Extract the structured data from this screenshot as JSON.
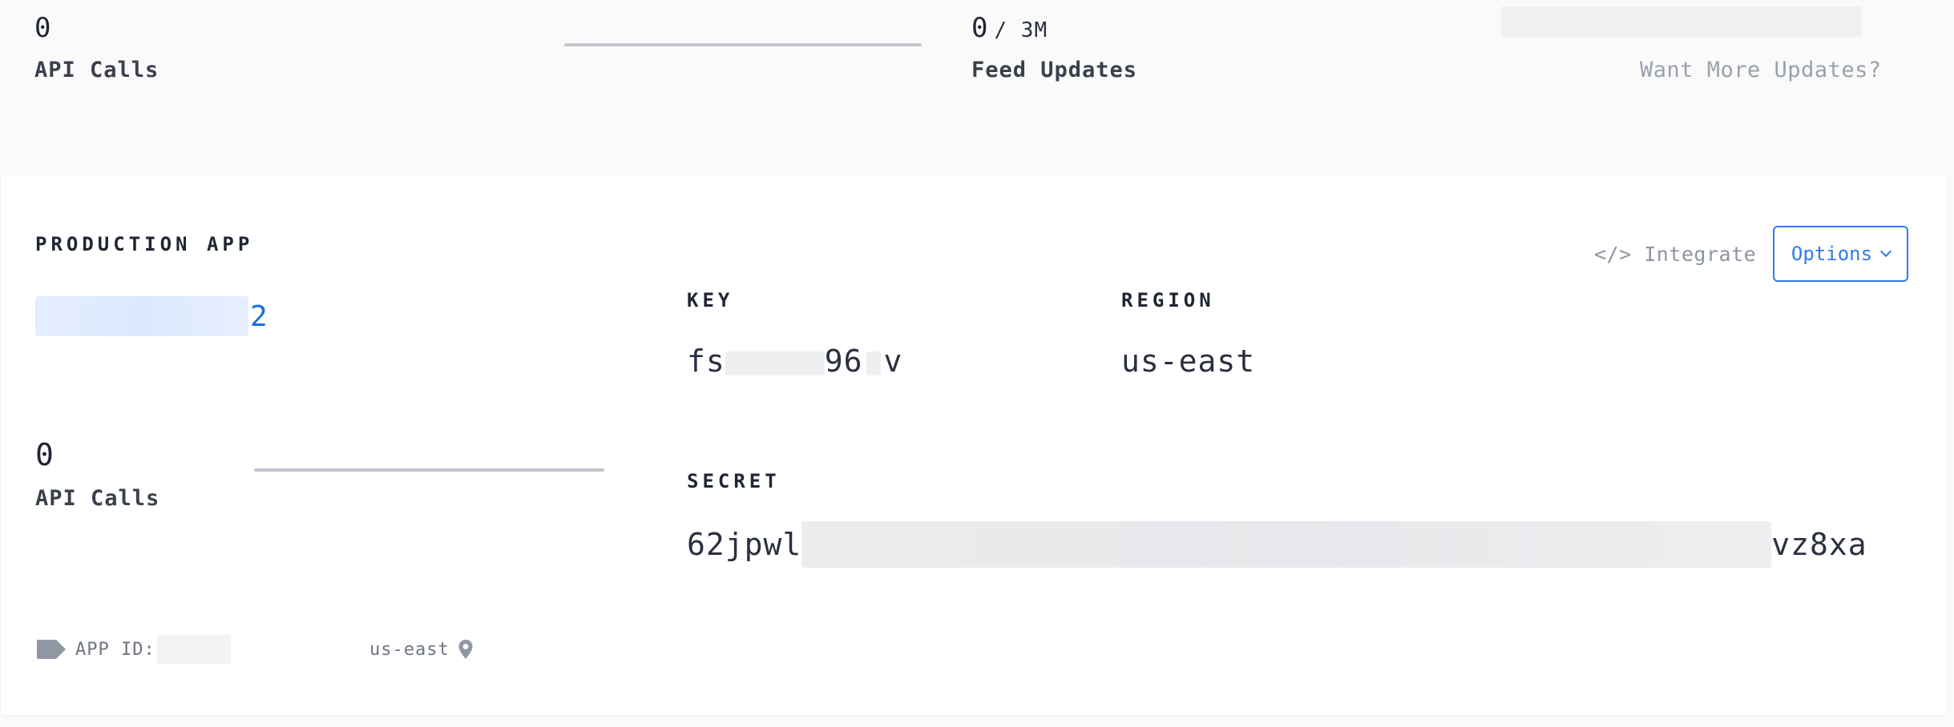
{
  "usage": {
    "api_calls": {
      "value": "0",
      "label": "API Calls",
      "progress": 0
    },
    "feed_updates": {
      "value": "0",
      "limit": "/ 3M",
      "label": "Feed Updates"
    },
    "more_updates_link": "Want More Updates?"
  },
  "app": {
    "section_heading": "PRODUCTION APP",
    "name_visible_suffix": "2",
    "integrate_label": "</> Integrate",
    "options_label": "Options",
    "api_calls": {
      "value": "0",
      "label": "API Calls",
      "progress": 0
    },
    "key": {
      "label": "KEY",
      "visible_start": "fs",
      "visible_mid": "96",
      "visible_end": "v"
    },
    "region": {
      "label": "REGION",
      "value": "us-east"
    },
    "secret": {
      "label": "SECRET",
      "visible_start": "62jpwl",
      "visible_end": "vz8xa"
    },
    "footer": {
      "app_id_label": "APP ID:",
      "region": "us-east"
    }
  },
  "colors": {
    "accent": "#2f7ce8",
    "link_blue": "#1a6fe0",
    "muted_text": "#9aa1ab",
    "bar_track": "#c3c7cd"
  },
  "icons": [
    "tag-icon",
    "map-pin-icon",
    "chevron-down-icon"
  ]
}
